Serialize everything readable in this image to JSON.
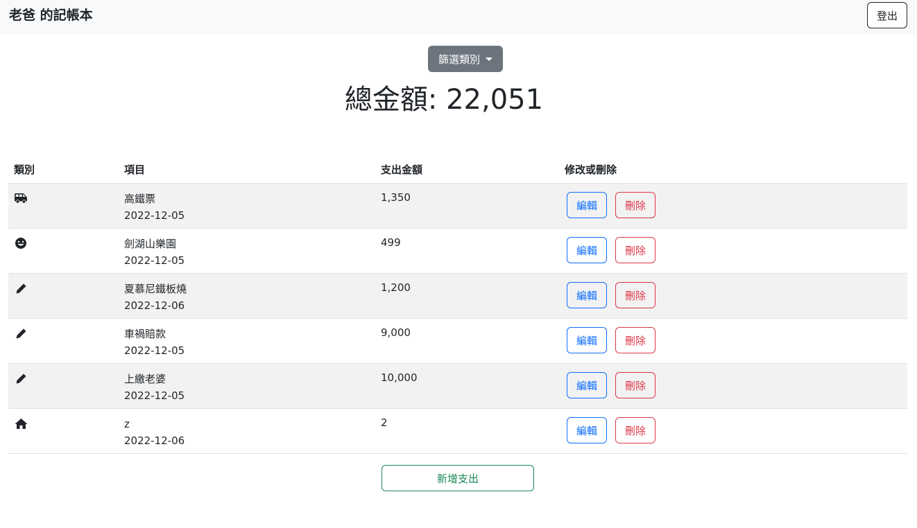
{
  "navbar": {
    "brand": "老爸 的記帳本",
    "logout_label": "登出"
  },
  "filter": {
    "label": "篩選類別"
  },
  "summary": {
    "total_label": "總金額: 22,051"
  },
  "table": {
    "headers": {
      "category": "類別",
      "item": "項目",
      "amount": "支出金額",
      "actions": "修改或刪除"
    },
    "rows": [
      {
        "icon": "shuttle-van-icon",
        "name": "高鐵票",
        "date": "2022-12-05",
        "amount": "1,350",
        "edit": "編輯",
        "delete": "刪除"
      },
      {
        "icon": "grin-icon",
        "name": "劍湖山樂園",
        "date": "2022-12-05",
        "amount": "499",
        "edit": "編輯",
        "delete": "刪除"
      },
      {
        "icon": "pen-icon",
        "name": "夏慕尼鐵板燒",
        "date": "2022-12-06",
        "amount": "1,200",
        "edit": "編輯",
        "delete": "刪除"
      },
      {
        "icon": "pen-icon",
        "name": "車禍賠款",
        "date": "2022-12-05",
        "amount": "9,000",
        "edit": "編輯",
        "delete": "刪除"
      },
      {
        "icon": "pen-icon",
        "name": "上繳老婆",
        "date": "2022-12-05",
        "amount": "10,000",
        "edit": "編輯",
        "delete": "刪除"
      },
      {
        "icon": "home-icon",
        "name": "z",
        "date": "2022-12-06",
        "amount": "2",
        "edit": "編輯",
        "delete": "刪除"
      }
    ]
  },
  "add_button": {
    "label": "新增支出"
  },
  "colors": {
    "primary": "#0d6efd",
    "danger": "#dc3545",
    "success": "#198754",
    "secondary": "#6c757d"
  }
}
